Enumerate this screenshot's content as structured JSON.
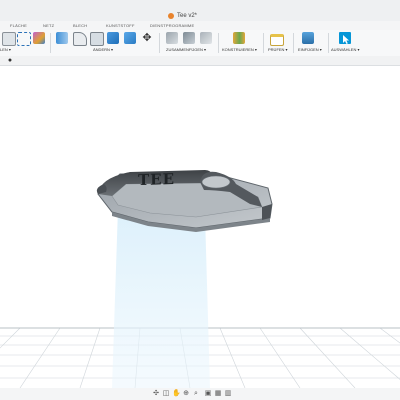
{
  "window": {
    "title": "Tee v2*"
  },
  "tabs": [
    {
      "label": "FLÄCHE"
    },
    {
      "label": "NETZ"
    },
    {
      "label": "BLECH"
    },
    {
      "label": "KUNSTSTOFF"
    },
    {
      "label": "DIENSTPROGRAMME"
    }
  ],
  "toolbar": {
    "groups": [
      {
        "label": "LEN ▾"
      },
      {
        "label": "ÄNDERN ▾"
      },
      {
        "label": "ZUSAMMENFÜGEN ▾"
      },
      {
        "label": "KONSTRUIEREN ▾"
      },
      {
        "label": "PRÜFEN ▾"
      },
      {
        "label": "EINFÜGEN ▾"
      },
      {
        "label": "AUSWÄHLEN ▾"
      }
    ]
  },
  "model": {
    "text": "TEE"
  },
  "colors": {
    "accent": "#0696d7",
    "model_dark": "#606468",
    "model_light": "#9aa0a6",
    "projection": "#cfe9f8"
  },
  "icons": [
    "extrude-icon",
    "box-icon",
    "sketch-icon",
    "press-pull-icon",
    "fillet-icon",
    "chamfer-icon",
    "shell-icon",
    "move-icon",
    "joint-icon",
    "rigid-group-icon",
    "plane-icon",
    "measure-icon",
    "insert-image-icon",
    "select-arrow-icon",
    "orbit-icon",
    "pan-icon",
    "zoom-icon",
    "display-mode-icon",
    "grid-icon"
  ]
}
